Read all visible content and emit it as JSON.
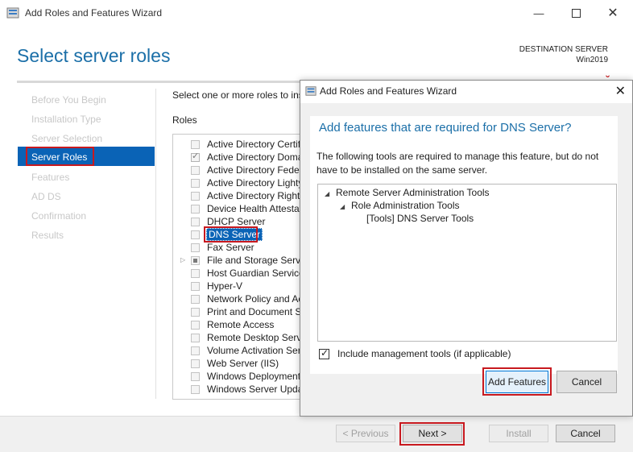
{
  "window": {
    "title": "Add Roles and Features Wizard",
    "minimize_icon": "minimize-icon",
    "maximize_icon": "maximize-icon",
    "close_icon": "close-icon"
  },
  "header": {
    "page_title": "Select server roles",
    "destination_label": "DESTINATION SERVER",
    "destination_name": "Win2019"
  },
  "nav": {
    "items": [
      {
        "label": "Before You Begin"
      },
      {
        "label": "Installation Type"
      },
      {
        "label": "Server Selection"
      },
      {
        "label": "Server Roles"
      },
      {
        "label": "Features"
      },
      {
        "label": "AD DS"
      },
      {
        "label": "Confirmation"
      },
      {
        "label": "Results"
      }
    ],
    "active_index": 3
  },
  "content": {
    "intro": "Select one or more roles to ins",
    "roles_heading": "Roles",
    "roles": [
      {
        "label": "Active Directory Certif",
        "state": "unchecked"
      },
      {
        "label": "Active Directory Doma",
        "state": "checked"
      },
      {
        "label": "Active Directory Feder",
        "state": "unchecked"
      },
      {
        "label": "Active Directory Lighty",
        "state": "unchecked"
      },
      {
        "label": "Active Directory Right",
        "state": "unchecked"
      },
      {
        "label": "Device Health Attestat",
        "state": "unchecked"
      },
      {
        "label": "DHCP Server",
        "state": "unchecked"
      },
      {
        "label": "DNS Server",
        "state": "unchecked"
      },
      {
        "label": "Fax Server",
        "state": "unchecked"
      },
      {
        "label": "File and Storage Servic",
        "state": "partial"
      },
      {
        "label": "Host Guardian Service",
        "state": "unchecked"
      },
      {
        "label": "Hyper-V",
        "state": "unchecked"
      },
      {
        "label": "Network Policy and Ac",
        "state": "unchecked"
      },
      {
        "label": "Print and Document S",
        "state": "unchecked"
      },
      {
        "label": "Remote Access",
        "state": "unchecked"
      },
      {
        "label": "Remote Desktop Servi",
        "state": "unchecked"
      },
      {
        "label": "Volume Activation Ser",
        "state": "unchecked"
      },
      {
        "label": "Web Server (IIS)",
        "state": "unchecked"
      },
      {
        "label": "Windows Deployment",
        "state": "unchecked"
      },
      {
        "label": "Windows Server Upda",
        "state": "unchecked"
      }
    ],
    "selected_role": "DNS Server"
  },
  "footer": {
    "previous_label": "< Previous",
    "next_label": "Next >",
    "install_label": "Install",
    "cancel_label": "Cancel"
  },
  "dialog": {
    "title": "Add Roles and Features Wizard",
    "heading": "Add features that are required for DNS Server?",
    "description": "The following tools are required to manage this feature, but do not have to be installed on the same server.",
    "tree": [
      "Remote Server Administration Tools",
      "Role Administration Tools",
      "[Tools] DNS Server Tools"
    ],
    "include_tools_label": "Include management tools (if applicable)",
    "include_tools_checked": true,
    "add_features_label": "Add Features",
    "cancel_label": "Cancel"
  },
  "colors": {
    "accent": "#1b6fa8",
    "nav_active": "#0a63b6",
    "highlight_box": "#c8191f"
  }
}
